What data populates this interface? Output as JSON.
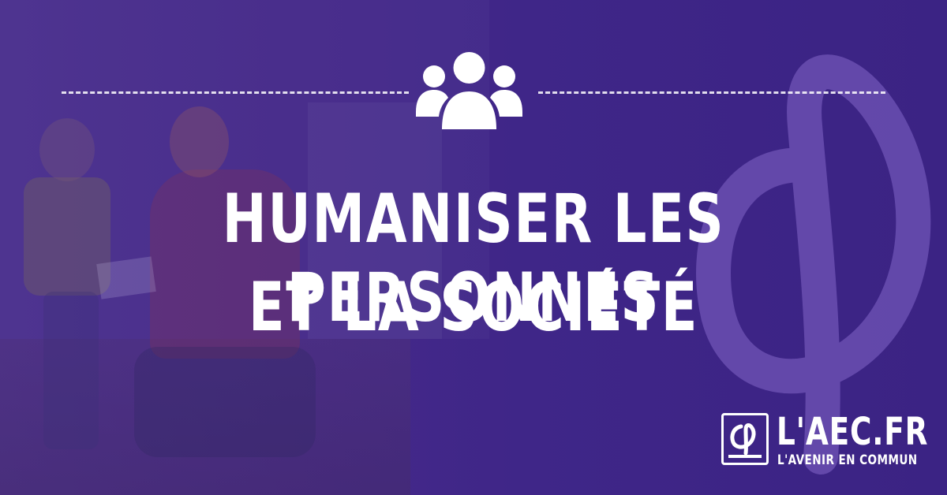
{
  "headline": {
    "line1": "HUMANISER LES PERSONNES",
    "line2": "ET LA SOCIÉTÉ"
  },
  "brand": {
    "name": "L'AEC.FR",
    "tagline": "L'AVENIR EN COMMUN"
  },
  "icons": {
    "top": "people-group-icon",
    "brand": "phi-logo-icon"
  },
  "colors": {
    "background": "#3f2688",
    "accent": "#6a4fb0",
    "text": "#ffffff"
  }
}
